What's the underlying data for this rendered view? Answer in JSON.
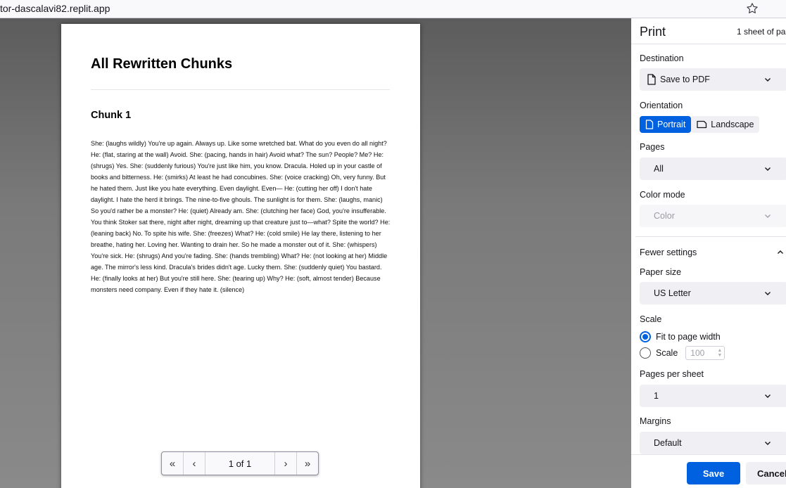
{
  "browser": {
    "url": "tor-dascalavi82.replit.app",
    "bookmark_icon": "star-icon"
  },
  "preview": {
    "title": "All Rewritten Chunks",
    "chunk_title": "Chunk 1",
    "chunk_body": "She: (laughs wildly) You're up again. Always up. Like some wretched bat. What do you even do all night? He: (flat, staring at the wall) Avoid. She: (pacing, hands in hair) Avoid what? The sun? People? Me? He: (shrugs) Yes. She: (suddenly furious) You're just like him, you know. Dracula. Holed up in your castle of books and bitterness. He: (smirks) At least he had concubines. She: (voice cracking) Oh, very funny. But he hated them. Just like you hate everything. Even daylight. Even— He: (cutting her off) I don't hate daylight. I hate the herd it brings. The nine-to-five ghouls. The sunlight is for them. She: (laughs, manic) So you'd rather be a monster? He: (quiet) Already am. She: (clutching her face) God, you're insufferable. You think Stoker sat there, night after night, dreaming up that creature just to—what? Spite the world? He: (leaning back) No. To spite his wife. She: (freezes) What? He: (cold smile) He lay there, listening to her breathe, hating her. Loving her. Wanting to drain her. So he made a monster out of it. She: (whispers) You're sick. He: (shrugs) And you're fading. She: (hands trembling) What? He: (not looking at her) Middle age. The mirror's less kind. Dracula's brides didn't age. Lucky them. She: (suddenly quiet) You bastard. He: (finally looks at her) But you're still here. She: (tearing up) Why? He: (soft, almost tender) Because monsters need company. Even if they hate it. (silence)",
    "pager": {
      "first": "«",
      "prev": "‹",
      "count": "1 of 1",
      "next": "›",
      "last": "»"
    }
  },
  "print": {
    "title": "Print",
    "sheets": "1 sheet of pa",
    "destination_label": "Destination",
    "destination_value": "Save to PDF",
    "orientation_label": "Orientation",
    "orientation_portrait": "Portrait",
    "orientation_landscape": "Landscape",
    "orientation_selected": "Portrait",
    "pages_label": "Pages",
    "pages_value": "All",
    "color_label": "Color mode",
    "color_value": "Color",
    "fewer_settings": "Fewer settings",
    "paper_label": "Paper size",
    "paper_value": "US Letter",
    "scale_label": "Scale",
    "scale_fit": "Fit to page width",
    "scale_custom": "Scale",
    "scale_value": "100",
    "pps_label": "Pages per sheet",
    "pps_value": "1",
    "margins_label": "Margins",
    "margins_value": "Default",
    "save": "Save",
    "cancel": "Cancel"
  },
  "colors": {
    "accent": "#0061e0",
    "preview_bg": "#777777"
  }
}
